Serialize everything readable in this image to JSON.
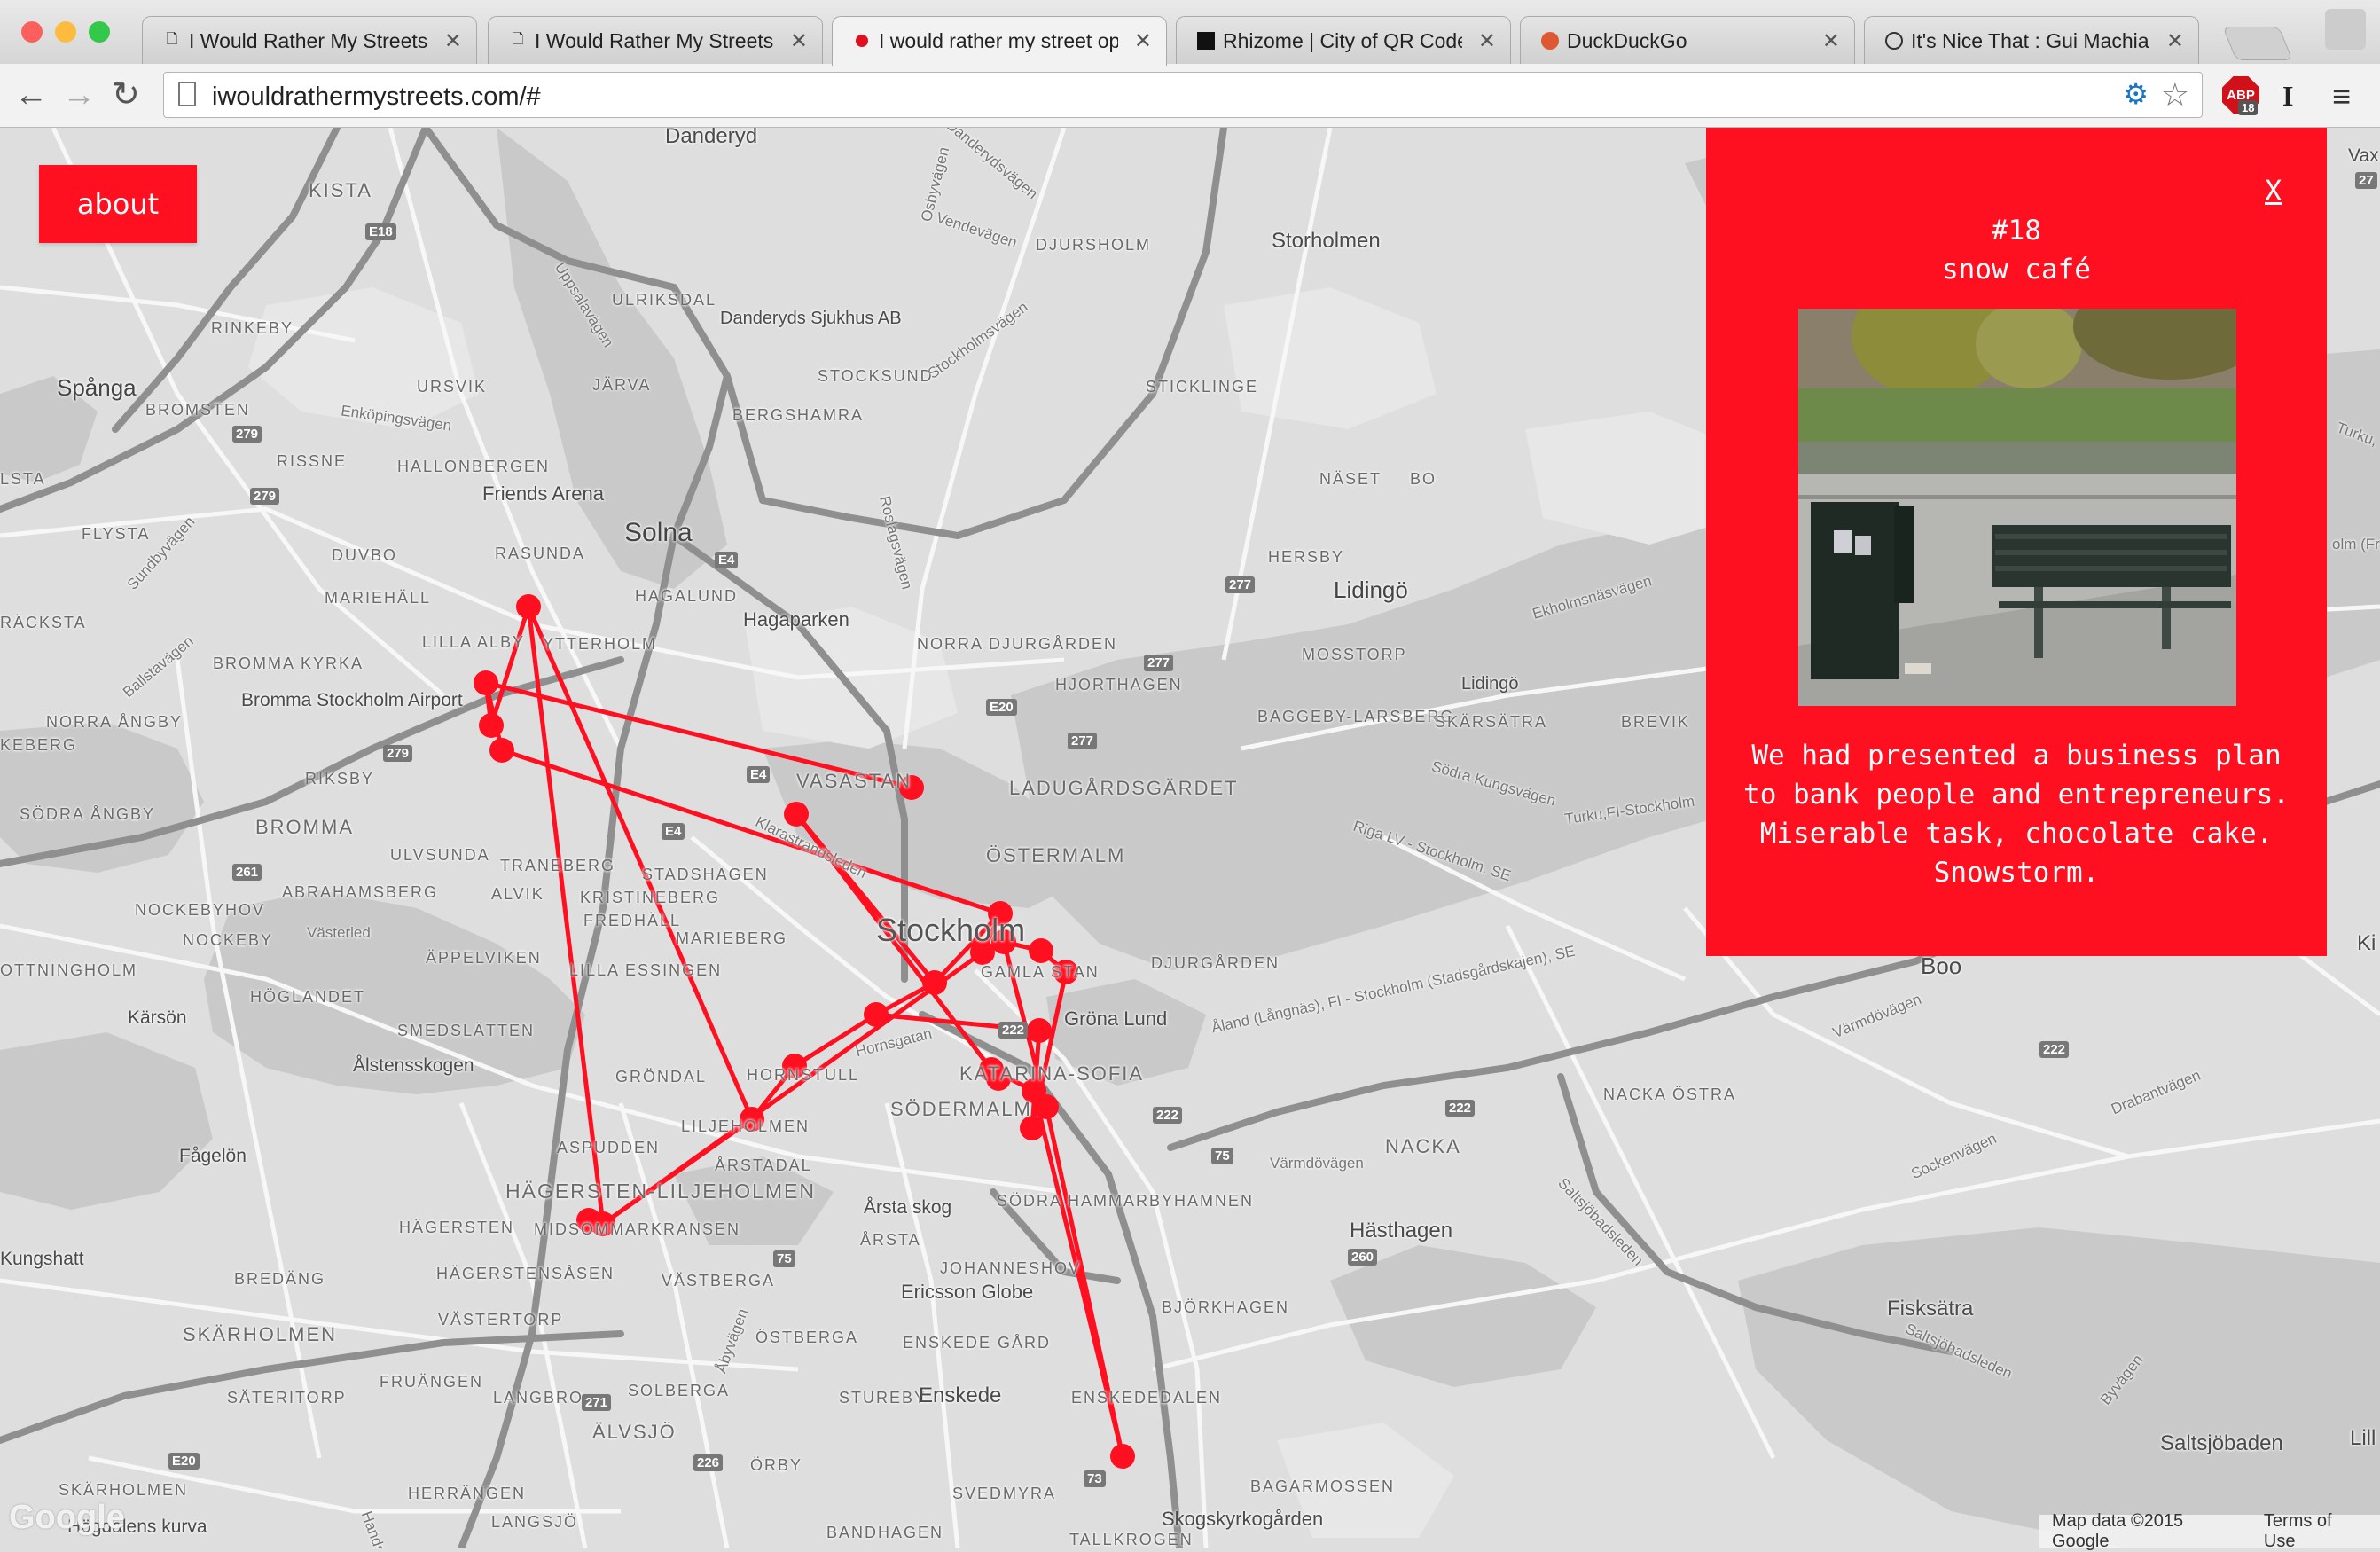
{
  "browser": {
    "tabs": [
      {
        "title": "I Would Rather My Streets",
        "favicon": "page-icon",
        "active": false
      },
      {
        "title": "I Would Rather My Streets",
        "favicon": "page-icon",
        "active": false
      },
      {
        "title": "I would rather my street op",
        "favicon": "red-dot-icon",
        "active": true
      },
      {
        "title": "Rhizome | City of QR Code",
        "favicon": "rhizome-icon",
        "active": false
      },
      {
        "title": "DuckDuckGo",
        "favicon": "duckduckgo-icon",
        "active": false
      },
      {
        "title": "It's Nice That : Gui Machia",
        "favicon": "itsnicethat-icon",
        "active": false
      }
    ],
    "url": "iwouldrathermystreets.com/#",
    "close_glyph": "✕",
    "back_glyph": "←",
    "forward_glyph": "→",
    "reload_glyph": "↻",
    "star_glyph": "☆",
    "menu_glyph": "≡",
    "ext_abp_label": "ABP",
    "ext_abp_count": "18",
    "ext_i_label": "I"
  },
  "page": {
    "about_label": "about",
    "accent_color": "#fe1021",
    "panel": {
      "close_label": "X",
      "number": "#18",
      "title": "snow café",
      "description": "We had presented a business plan to bank people and entrepreneurs. Miserable task, chocolate cake. Snowstorm."
    }
  },
  "map": {
    "labels": {
      "danderyd": "Danderyd",
      "kista": "KISTA",
      "e18a": "E18",
      "rinkeby": "RINKEBY",
      "ulriksdal": "ULRIKSDAL",
      "danderyds_sjukhus": "Danderyds Sjukhus AB",
      "djursholm": "DJURSHOLM",
      "storholmen": "Storholmen",
      "spanga": "Spånga",
      "bromsten": "BROMSTEN",
      "ursvik": "URSVIK",
      "jarva": "JÄRVA",
      "stocksund": "STOCKSUND",
      "bergshamra": "BERGSHAMRA",
      "sticklinge": "STICKLINGE",
      "r279a": "279",
      "rissne": "RISSNE",
      "hallonbergen": "HALLONBERGEN",
      "friends_arena": "Friends Arena",
      "naset": "NÄSET",
      "bo": "BO",
      "r279b": "279",
      "lsta": "LSTA",
      "flysta": "FLYSTA",
      "solna": "Solna",
      "duvbo": "DUVBO",
      "rasunda": "RASUNDA",
      "e4a": "E4",
      "herserud": "HERSBY",
      "r277a": "277",
      "lidingo_big": "Lidingö",
      "mariehall": "MARIEHÄLL",
      "hagalund": "HAGALUND",
      "hagaparken": "Hagaparken",
      "racksta": "RÄCKSTA",
      "lilla_alby": "LILLA ALBY",
      "ytterholm": "YTTERHOLM",
      "norra_djurgarden": "NORRA DJURGÅRDEN",
      "r277b": "277",
      "mosstorp": "MOSSTORP",
      "lidingo_small": "Lidingö",
      "bromma_kyrka": "BROMMA KYRKA",
      "bromma_airport": "Bromma Stockholm Airport",
      "hjorthagen": "HJORTHAGEN",
      "e20a": "E20",
      "baggeby": "BAGGEBY-LARSBERG",
      "skarsatra": "SKÄRSÄTRA",
      "brevik": "BREVIK",
      "norra_angby": "NORRA ÅNGBY",
      "r279c": "279",
      "r277c": "277",
      "keberg": "KEBERG",
      "riksby": "RIKSBY",
      "e4b": "E4",
      "vasastan": "VASASTAN",
      "ladugardsgardet": "LADUGÅRDSGÄRDET",
      "sodra_angby": "SÖDRA ÅNGBY",
      "bromma": "BROMMA",
      "e4c": "E4",
      "ulvsunda": "ULVSUNDA",
      "traneberg": "TRANEBERG",
      "stadshagen": "STADSHAGEN",
      "ostermalm": "ÖSTERMALM",
      "r261": "261",
      "abrahamsberg": "ABRAHAMSBERG",
      "alvik": "ALVIK",
      "kristineberg": "KRISTINEBERG",
      "nockebyhov": "NOCKEBYHOV",
      "nockeby": "NOCKEBY",
      "vasterled": "Västerled",
      "fredhall": "FREDHÄLL",
      "marieberg": "MARIEBERG",
      "stockholm": "Stockholm",
      "appelviken": "ÄPPELVIKEN",
      "lilla_essingen": "LILLA ESSINGEN",
      "djurgarden": "DJURGÅRDEN",
      "boo": "Boo",
      "ottningholm": "OTTNINGHOLM",
      "hoglandet": "HÖGLANDET",
      "gamla_stan": "GAMLA STAN",
      "grona_lund": "Gröna Lund",
      "karson": "Kärsön",
      "smedslatten": "SMEDSLÄTTEN",
      "r222a": "222",
      "hornsgatan": "Hornsgatan",
      "r222b": "222",
      "alstensskogen": "Ålstensskogen",
      "grondal": "GRÖNDAL",
      "hornstull": "HORNSTULL",
      "katarina": "KATARINA-SOFIA",
      "nacka_ostra": "NACKA ÖSTRA",
      "r222c": "222",
      "sodermalm": "SÖDERMALM",
      "liljeholmen": "LILJEHOLMEN",
      "r222d": "222",
      "nacka": "NACKA",
      "fagelon": "Fågelön",
      "aspudden": "ASPUDDEN",
      "arstadal": "ÅRSTADAL",
      "r75a": "75",
      "varmdovagen": "Värmdövägen",
      "hagersten_liljeholmen": "HÄGERSTEN-LILJEHOLMEN",
      "arsta_skog": "Årsta skog",
      "sodra_hammarby": "SÖDRA HAMMARBYHAMNEN",
      "hasthagen": "Hästhagen",
      "hagersten": "HÄGERSTEN",
      "midsommarkransen": "MIDSOMMARKRANSEN",
      "arsta": "ÅRSTA",
      "r260": "260",
      "kungshatt": "Kungshatt",
      "r75b": "75",
      "johanneshov": "JOHANNESHOV",
      "bredang": "BREDÄNG",
      "hagerstensasen": "HÄGERSTENSÅSEN",
      "vastberga": "VÄSTBERGA",
      "ericsson_globe": "Ericsson Globe",
      "bjorkhagen": "BJÖRKHAGEN",
      "fisksatra": "Fisksätra",
      "vastertorp": "VÄSTERTORP",
      "skarholmen": "SKÄRHOLMEN",
      "ostberga": "ÖSTBERGA",
      "enskede_gard": "ENSKEDE GÅRD",
      "fruangen": "FRUÄNGEN",
      "sateritorp": "SÄTERITORP",
      "langbro": "LANGBRO",
      "r271": "271",
      "solberga": "SOLBERGA",
      "stureby": "STUREBY",
      "enskede": "Enskede",
      "enskededalen": "ENSKEDEDALEN",
      "alvsjo": "ÄLVSJÖ",
      "e20b": "E20",
      "r226": "226",
      "orby": "ÖRBY",
      "saltsjobaden": "Saltsjöbaden",
      "skarholmen_small": "SKÄRHOLMEN",
      "herrangen": "HERRÄNGEN",
      "svedmyra": "SVEDMYRA",
      "r73": "73",
      "bagarmossen": "BAGARMOSSEN",
      "skogskyrkogarden": "Skogskyrkogården",
      "langsjo": "LANGSJÖ",
      "bandhagen": "BANDHAGEN",
      "tallkrogen": "TALLKROGEN",
      "hagens_kurva": "Högdalens kurva",
      "uppsalavagen": "Uppsalavägen",
      "enkopingsvagen": "Enköpingsvägen",
      "sundbyvagen": "Sundbyvägen",
      "ballstavagen": "Ballstavägen",
      "vendevagen": "Vendevägen",
      "danderydsvagen": "Danderydsvägen",
      "osbyvagen": "Osbyvägen",
      "stockholmsvagen": "Stockholmsvägen",
      "roslagsvagen": "Roslagsvägen",
      "ekholmsnasvagen": "Ekholmsnäsvägen",
      "sodra_kungsvagen": "Södra Kungsvägen",
      "riga_route": "Riga LV - Stockholm, SE",
      "turku_route": "Turku,FI-Stockholm",
      "aland_route": "Åland (Långnäs), FI - Stockholm (Stadsgårdskajen), SE",
      "saltsjobadsleden": "Saltsjöbadsleden",
      "sockenvagen": "Sockenvägen",
      "drabantvagen": "Drabantvägen",
      "varmdovagen2": "Värmdövägen",
      "klarastrandsleden": "Klarastrandsleden",
      "byvagen": "Byvägen",
      "abyvagen": "Åbyvägen",
      "saltsjobadsleden2": "Saltsjöbadsleden",
      "vax": "Vax",
      "turku_edge": "Turku,",
      "r27": "27",
      "olm": "olm (Fr",
      "ki": "Ki",
      "lill": "Lill",
      "hand": "Hands"
    },
    "google_logo": "Google",
    "attribution": "Map data ©2015 Google",
    "terms": "Terms of Use",
    "route_color": "#fe1021",
    "marker_count": 24
  }
}
